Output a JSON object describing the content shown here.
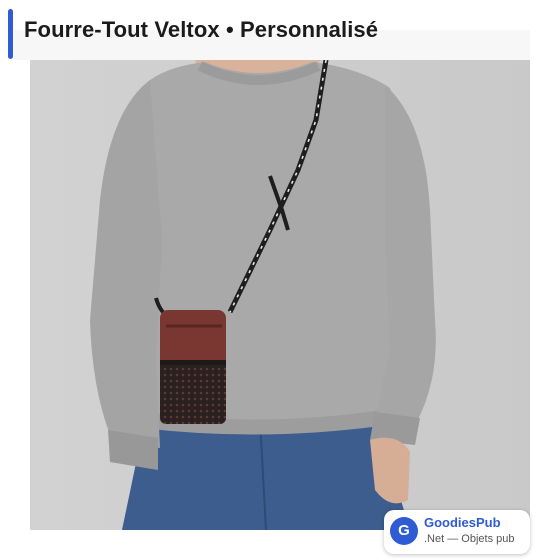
{
  "header": {
    "title": "Fourre-Tout Veltox • Personnalisé",
    "accent_color": "#2f5bd3"
  },
  "photo": {
    "subject": "product-photo"
  },
  "badge": {
    "logo_letter": "G",
    "name": "GoodiesPub",
    "subtitle": ".Net — Objets pub",
    "brand_color": "#2f5bd3"
  }
}
